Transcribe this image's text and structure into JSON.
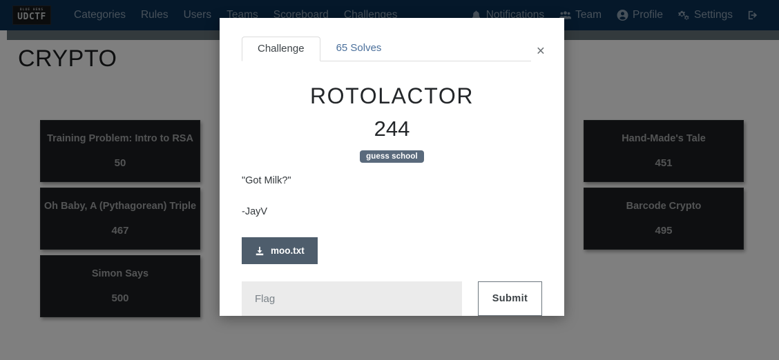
{
  "navbar": {
    "brand": {
      "top_text": "BLUE HENS",
      "main_text": "UDCTF"
    },
    "left_items": [
      {
        "label": "Categories"
      },
      {
        "label": "Rules"
      },
      {
        "label": "Users"
      },
      {
        "label": "Teams"
      },
      {
        "label": "Scoreboard"
      },
      {
        "label": "Challenges"
      }
    ],
    "right_items": [
      {
        "label": "Notifications",
        "icon": "bell-icon"
      },
      {
        "label": "Team",
        "icon": "users-icon"
      },
      {
        "label": "Profile",
        "icon": "user-circle-icon"
      },
      {
        "label": "Settings",
        "icon": "gears-icon"
      },
      {
        "label": "",
        "icon": "logout-icon"
      }
    ],
    "background_color": "#0b3054"
  },
  "page": {
    "category_title": "CRYPTO",
    "cards": [
      {
        "title": "Training Problem: Intro to RSA",
        "points": "50"
      },
      {
        "title": "Oh Baby, A (Pythagorean) Triple",
        "points": "467"
      },
      {
        "title": "Simon Says",
        "points": "500"
      },
      {
        "title": "Hand-Made's Tale",
        "points": "451"
      },
      {
        "title": "Barcode Crypto",
        "points": "495"
      }
    ],
    "card_background": "#1c1f22"
  },
  "modal": {
    "tabs": [
      {
        "label": "Challenge",
        "active": true
      },
      {
        "label": "65 Solves",
        "active": false
      }
    ],
    "close_label": "×",
    "challenge": {
      "title": "ROTOLACTOR",
      "points": "244",
      "tag": "guess school",
      "description_line_1": "\"Got Milk?\"",
      "description_line_2": "-JayV",
      "file_name": "moo.txt",
      "flag_placeholder": "Flag",
      "flag_value": "",
      "submit_label": "Submit",
      "tag_color": "#5a6a7c",
      "file_button_color": "#4e5d6c"
    }
  }
}
